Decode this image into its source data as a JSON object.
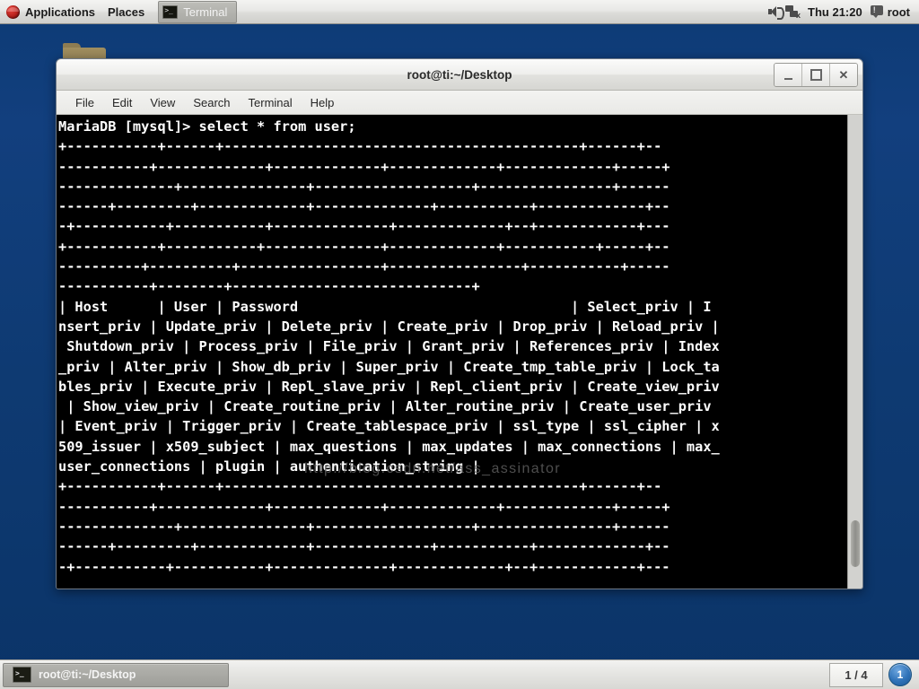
{
  "top_panel": {
    "logo_icon": "fedora-logo-icon",
    "applications_label": "Applications",
    "places_label": "Places",
    "task_window": {
      "icon": "terminal-icon",
      "label": "Terminal"
    },
    "speaker_icon": "speaker-volume-icon",
    "network_icon": "network-disconnected-icon",
    "clock": "Thu 21:20",
    "user_icon": "user-message-icon",
    "user_name": "root"
  },
  "desktop": {
    "folder_icon": "folder-icon"
  },
  "window": {
    "title": "root@ti:~/Desktop",
    "controls": {
      "minimize_label": "_",
      "maximize_label": "□",
      "close_label": "✕"
    },
    "menu": [
      "File",
      "Edit",
      "View",
      "Search",
      "Terminal",
      "Help"
    ]
  },
  "terminal": {
    "watermark": "http://blog.csdn.net/ass_assinator",
    "background_color": "#000000",
    "foreground_color": "#ffffff",
    "lines": [
      "MariaDB [mysql]> select * from user;",
      "+-----------+------+-------------------------------------------+------+--",
      "-----------+-------------+-------------+-------------+-------------+-----+",
      "--------------+---------------+-------------------+----------------+------",
      "------+---------+-------------+--------------+-----------+-------------+--",
      "-+-----------+-----------+--------------+-------------+--+------------+---",
      "+-----------+-----------+--------------+-------------+-----------+-----+--",
      "----------+----------+-----------------+----------------+-----------+-----",
      "-----------+--------+-----------------------------+",
      "| Host      | User | Password                                 | Select_priv | I",
      "nsert_priv | Update_priv | Delete_priv | Create_priv | Drop_priv | Reload_priv |",
      " Shutdown_priv | Process_priv | File_priv | Grant_priv | References_priv | Index",
      "_priv | Alter_priv | Show_db_priv | Super_priv | Create_tmp_table_priv | Lock_ta",
      "bles_priv | Execute_priv | Repl_slave_priv | Repl_client_priv | Create_view_priv",
      " | Show_view_priv | Create_routine_priv | Alter_routine_priv | Create_user_priv",
      "| Event_priv | Trigger_priv | Create_tablespace_priv | ssl_type | ssl_cipher | x",
      "509_issuer | x509_subject | max_questions | max_updates | max_connections | max_",
      "user_connections | plugin | authentication_string |",
      "+-----------+------+-------------------------------------------+------+--",
      "-----------+-------------+-------------+-------------+-------------+-----+",
      "--------------+---------------+-------------------+----------------+------",
      "------+---------+-------------+--------------+-----------+-------------+--",
      "-+-----------+-----------+--------------+-------------+--+------------+---"
    ],
    "scrollbar": "vertical-scrollbar"
  },
  "bottom_panel": {
    "task_button": {
      "icon": "terminal-icon",
      "label": "root@ti:~/Desktop"
    },
    "workspace_switcher": "1 / 4",
    "workspace_indicator": "1"
  }
}
